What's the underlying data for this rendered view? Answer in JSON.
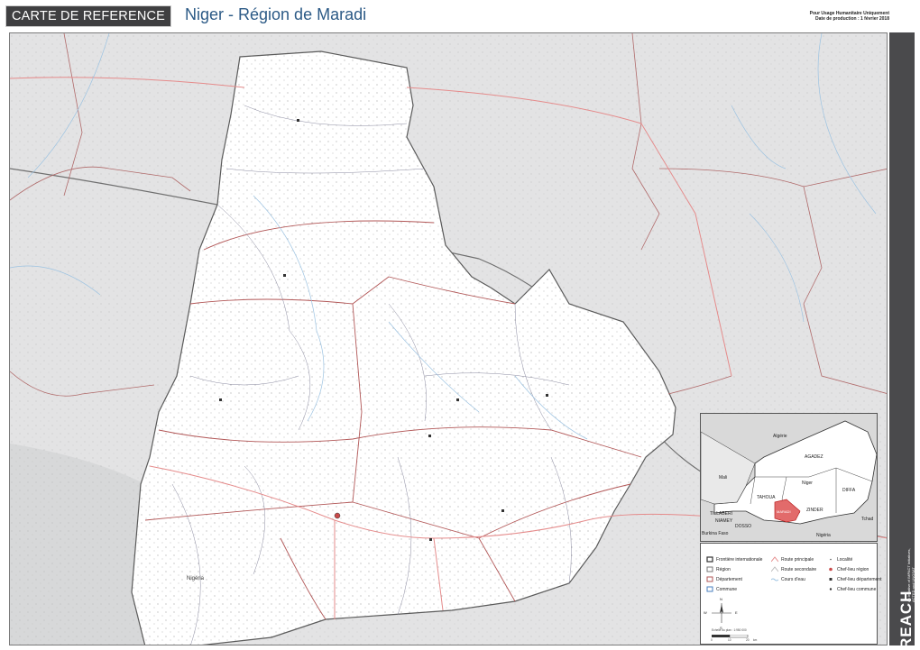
{
  "header": {
    "badge": "CARTE DE REFERENCE",
    "title": "Niger - Région de Maradi",
    "usage": "Pour Usage Humanitaire Uniquement",
    "date": "Date de production : 1 février 2018"
  },
  "map": {
    "country_label": "Nigéria",
    "colors": {
      "region_fill": "#ffffff",
      "outside_fill": "#e3e3e4",
      "border": "#555555",
      "road_main": "#e58b8b",
      "road_dept": "#b65151",
      "river": "#9cc3e2"
    }
  },
  "inset": {
    "labels": {
      "algeria": "Algérie",
      "mali": "Mali",
      "agadez": "AGADEZ",
      "niger": "Niger",
      "diffa": "DIFFA",
      "tahoua": "TAHOUA",
      "zinder": "ZINDER",
      "tillaberi": "TILLABERI",
      "niamey": "NIAMEY",
      "dosso": "DOSSO",
      "maradi": "MARADI",
      "nigeria": "Nigéria",
      "tchad": "Tchad",
      "burkina": "Burkina Faso"
    }
  },
  "legend": {
    "items": [
      {
        "label": "Frontière internationale",
        "icon": "international-border"
      },
      {
        "label": "Région",
        "icon": "region-border"
      },
      {
        "label": "Département",
        "icon": "department-border"
      },
      {
        "label": "Commune",
        "icon": "commune-border"
      },
      {
        "label": "Route principale",
        "icon": "main-road"
      },
      {
        "label": "Route secondaire",
        "icon": "secondary-road"
      },
      {
        "label": "Cours d'eau",
        "icon": "river"
      },
      {
        "label": "Localité",
        "icon": "locality-dot"
      },
      {
        "label": "Chef-lieu région",
        "icon": "region-capital"
      },
      {
        "label": "Chef-lieu département",
        "icon": "department-capital"
      },
      {
        "label": "Chef-lieu commune",
        "icon": "commune-capital"
      }
    ],
    "scale_ticks": [
      "0",
      "10",
      "20"
    ],
    "scale_unit": "km",
    "scale_label": "Echelle du plan : 1:950 000",
    "compass": {
      "n": "N",
      "e": "E",
      "s": "S",
      "w": "W"
    }
  },
  "brand": {
    "name": "REACH",
    "tagline": "An initiative of IMPACT Initiatives, ACTED and UNOSAT"
  }
}
